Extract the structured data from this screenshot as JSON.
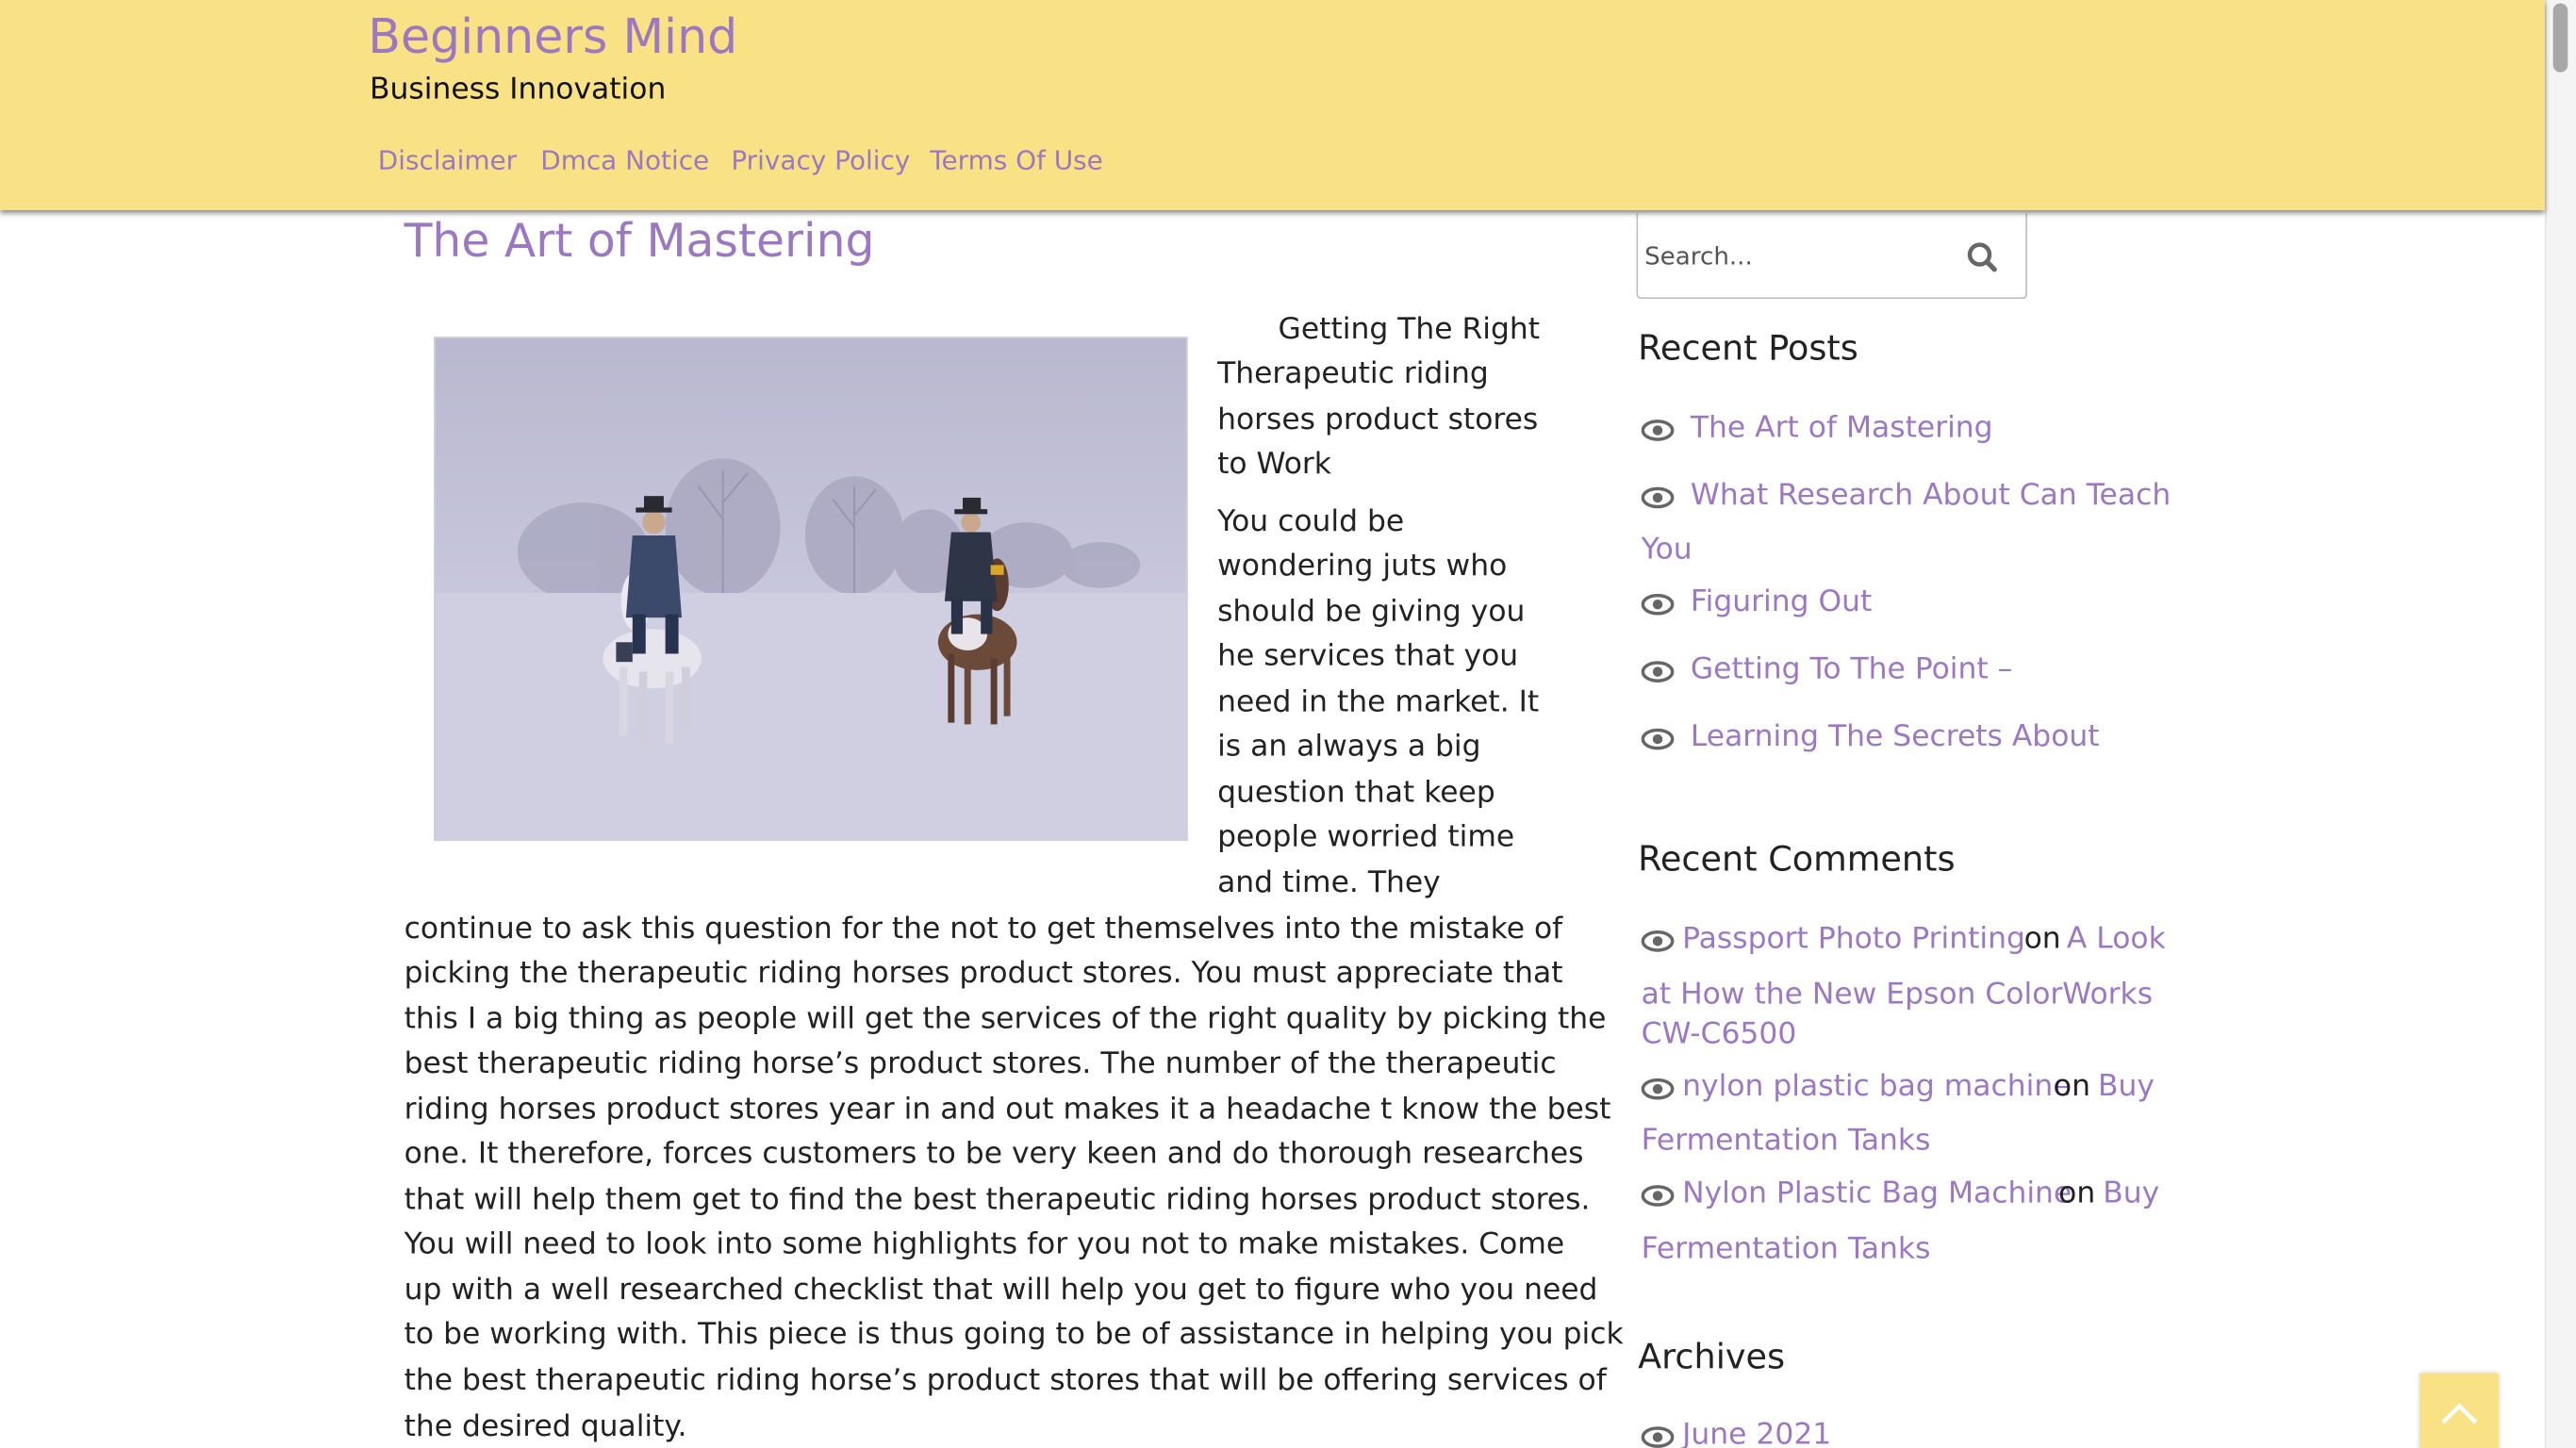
{
  "site": {
    "title": "Beginners Mind",
    "description": "Business Innovation"
  },
  "nav": [
    {
      "label": "Disclaimer"
    },
    {
      "label": "Dmca Notice"
    },
    {
      "label": "Privacy Policy"
    },
    {
      "label": "Terms Of Use"
    }
  ],
  "post": {
    "title": "The Art of Mastering",
    "image_icon": "horse-riders-snow-photo",
    "lines": [
      "Getting The Right",
      "Therapeutic riding",
      "horses product stores",
      "to Work",
      "You could be",
      "wondering juts who",
      "should be giving you",
      "he services that you",
      "need in the market. It",
      "is an always a big",
      "question that keep",
      "people worried time",
      "and time. They",
      "continue to ask this question for the not to get themselves into the mistake of",
      "picking the therapeutic riding horses product stores. You must appreciate that",
      "this I a big thing as people will get the services of the right quality by picking the",
      "best therapeutic riding horse’s product stores. The number of the therapeutic",
      "riding horses product stores year in and out makes it a headache t know the best",
      "one. It therefore, forces customers to be very keen and do thorough researches",
      "that will help them get to find the best therapeutic riding horses product stores.",
      "You will need to look into some highlights for you not to make mistakes. Come",
      "up with a well researched checklist that will help you get to figure who you need",
      "to be working with. This piece is thus going to be of assistance in helping you pick",
      "the best therapeutic riding horse’s product stores that will be offering services of",
      "the desired quality."
    ]
  },
  "search": {
    "placeholder": "Search...",
    "icon": "search-icon"
  },
  "recent_posts": {
    "title": "Recent Posts",
    "items": [
      {
        "label": "The Art of Mastering"
      },
      {
        "label_line1": "What Research About Can Teach",
        "label_line2": "You"
      },
      {
        "label": "Figuring Out"
      },
      {
        "label": "Getting To The Point –"
      },
      {
        "label": "Learning The Secrets About"
      }
    ]
  },
  "recent_comments": {
    "title": "Recent Comments",
    "on_word": "on",
    "items": [
      {
        "author": "Passport Photo Printing",
        "post_line1": "A Look",
        "post_line2": "at How the New Epson ColorWorks",
        "post_line3": "CW-C6500"
      },
      {
        "author": "nylon plastic bag machine",
        "post_line1": "Buy",
        "post_line2": "Fermentation Tanks"
      },
      {
        "author": "Nylon Plastic Bag Machine",
        "post_line1": "Buy",
        "post_line2": "Fermentation Tanks"
      }
    ]
  },
  "archives": {
    "title": "Archives",
    "items": [
      {
        "label": "June 2021"
      }
    ]
  },
  "colors": {
    "header_bg": "#f9e285",
    "link": "#9d78c2",
    "text": "#222222"
  }
}
